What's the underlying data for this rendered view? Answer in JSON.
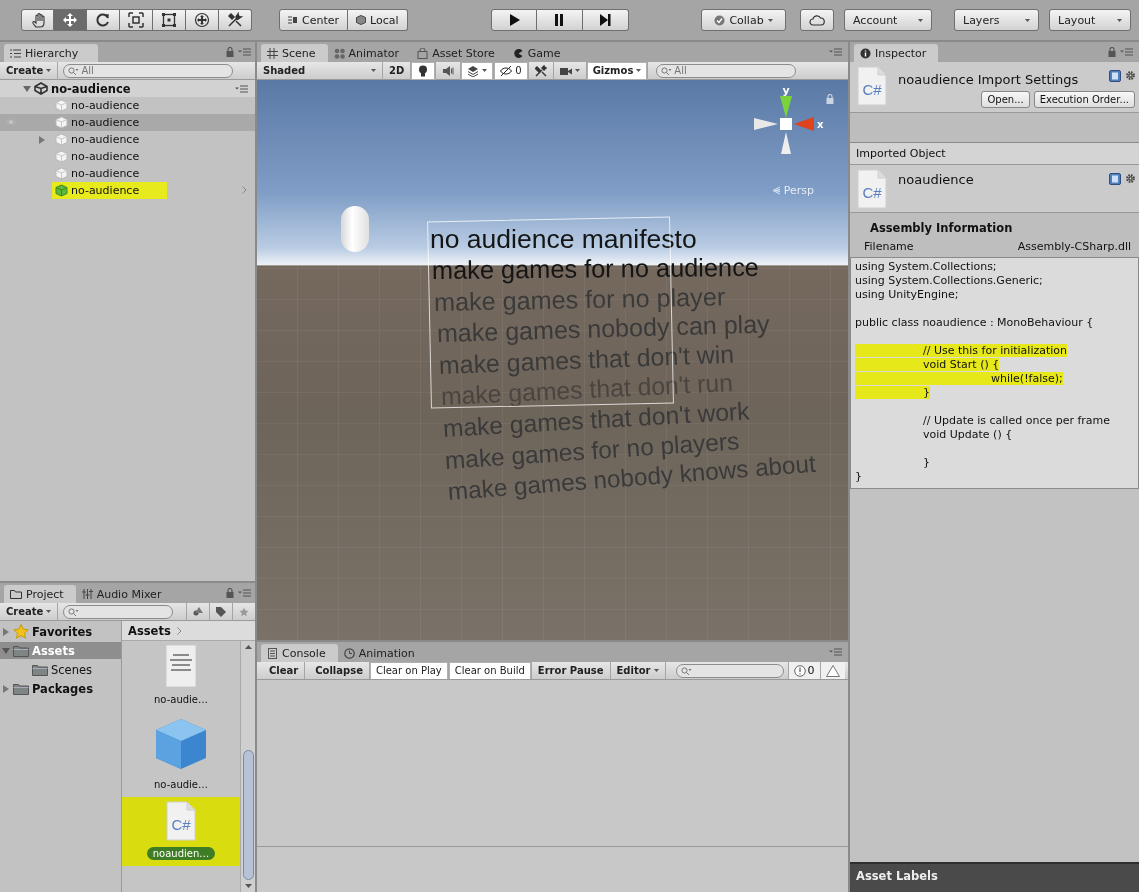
{
  "toolbar": {
    "tools": [
      {
        "kind": "hand",
        "selected": false
      },
      {
        "kind": "move",
        "selected": true
      },
      {
        "kind": "rotate",
        "selected": false
      },
      {
        "kind": "scale",
        "selected": false
      },
      {
        "kind": "rect",
        "selected": false
      },
      {
        "kind": "transform",
        "selected": false
      },
      {
        "kind": "custom",
        "selected": false
      }
    ],
    "pivot": [
      {
        "kind": "pivot",
        "label": "Center"
      },
      {
        "kind": "space",
        "label": "Local"
      }
    ],
    "playback": [
      {
        "kind": "play"
      },
      {
        "kind": "pause"
      },
      {
        "kind": "step"
      }
    ],
    "collab": "Collab",
    "account": "Account",
    "layers": "Layers",
    "layout": "Layout"
  },
  "hierarchy": {
    "tab": "Hierarchy",
    "create": "Create",
    "search_placeholder": "All",
    "scene": {
      "label": "no-audience",
      "expanded": true
    },
    "items": [
      {
        "label": "no-audience",
        "kind": "gameobject",
        "selected": false,
        "has_children": false,
        "marked": false
      },
      {
        "label": "no-audience",
        "kind": "gameobject",
        "selected": true,
        "has_children": false,
        "marked": false
      },
      {
        "label": "no-audience",
        "kind": "gameobject",
        "selected": false,
        "has_children": true,
        "marked": false
      },
      {
        "label": "no-audience",
        "kind": "gameobject",
        "selected": false,
        "has_children": false,
        "marked": false
      },
      {
        "label": "no-audience",
        "kind": "gameobject",
        "selected": false,
        "has_children": false,
        "marked": false
      },
      {
        "label": "no-audience",
        "kind": "prefab",
        "selected": false,
        "has_children": false,
        "marked": true
      }
    ]
  },
  "project": {
    "tabs": [
      {
        "label": "Project",
        "kind": "project",
        "selected": true
      },
      {
        "label": "Audio Mixer",
        "kind": "mixer",
        "selected": false
      }
    ],
    "create": "Create",
    "tree": [
      {
        "label": "Favorites",
        "kind": "favorites",
        "expanded": false,
        "selected": false
      },
      {
        "label": "Assets",
        "kind": "folder",
        "expanded": true,
        "selected": true,
        "children": [
          {
            "label": "Scenes",
            "kind": "folder",
            "selected": false
          }
        ]
      },
      {
        "label": "Packages",
        "kind": "folder",
        "expanded": false,
        "selected": false
      }
    ],
    "breadcrumb": "Assets",
    "assets": [
      {
        "label": "no-audie…",
        "kind": "scene",
        "selected": false,
        "marked": false
      },
      {
        "label": "no-audie…",
        "kind": "prefab",
        "selected": false,
        "marked": false
      },
      {
        "label": "noaudien…",
        "kind": "script",
        "icon_label": "C#",
        "selected": true,
        "marked": true
      }
    ]
  },
  "scene": {
    "tabs": [
      {
        "label": "Scene",
        "kind": "scene",
        "selected": true
      },
      {
        "label": "Animator",
        "kind": "animator",
        "selected": false
      },
      {
        "label": "Asset Store",
        "kind": "store",
        "selected": false
      },
      {
        "label": "Game",
        "kind": "game",
        "selected": false
      }
    ],
    "toolbar": {
      "shading": "Shaded",
      "two_d": {
        "label": "2D",
        "on": false
      },
      "toggles": [
        {
          "kind": "lighting",
          "on": true
        },
        {
          "kind": "audio",
          "on": false
        },
        {
          "kind": "effects",
          "on": true
        },
        {
          "kind": "hidden",
          "on": true,
          "label": "0"
        },
        {
          "kind": "tools",
          "on": false
        },
        {
          "kind": "camera",
          "on": false
        }
      ],
      "gizmos": {
        "label": "Gizmos",
        "on": true
      },
      "search_placeholder": "All"
    },
    "axes": [
      "y",
      "x"
    ],
    "projection": "Persp",
    "text_lines": [
      "no audience manifesto",
      "make games for no audience",
      "make games for no player",
      "make games nobody can play",
      "make games that don't win",
      "make games that don't run",
      "make games that don't work",
      "make games for no players",
      "make games nobody knows about"
    ]
  },
  "console": {
    "tabs": [
      {
        "label": "Console",
        "kind": "console",
        "selected": true
      },
      {
        "label": "Animation",
        "kind": "animation",
        "selected": false
      }
    ],
    "buttons": [
      {
        "label": "Clear",
        "on": false
      },
      {
        "label": "Collapse",
        "on": false
      },
      {
        "label": "Clear on Play",
        "on": true
      },
      {
        "label": "Clear on Build",
        "on": true
      },
      {
        "label": "Error Pause",
        "on": false
      }
    ],
    "target": "Editor",
    "counts": [
      {
        "kind": "info",
        "label": "0"
      },
      {
        "kind": "warning"
      }
    ]
  },
  "inspector": {
    "tab": "Inspector",
    "title": "noaudience Import Settings",
    "icon_label": "C#",
    "buttons": [
      "Open...",
      "Execution Order..."
    ],
    "section": "Imported Object",
    "object_icon_label": "C#",
    "object_name": "noaudience",
    "assembly_title": "Assembly Information",
    "field_label": "Filename",
    "field_value": "Assembly-CSharp.dll",
    "code": [
      {
        "text": "using System.Collections;",
        "marked": false,
        "blank_before": false
      },
      {
        "text": "using System.Collections.Generic;",
        "marked": false,
        "blank_before": false
      },
      {
        "text": "using UnityEngine;",
        "marked": false,
        "blank_before": false
      },
      {
        "text": "public class noaudience : MonoBehaviour {",
        "marked": false,
        "blank_before": true
      },
      {
        "text": "\t// Use this for initialization",
        "marked": true,
        "blank_before": true
      },
      {
        "text": "\tvoid Start () {",
        "marked": true,
        "blank_before": false
      },
      {
        "text": "\t\twhile(!false);",
        "marked": true,
        "blank_before": false
      },
      {
        "text": "\t}",
        "marked": true,
        "blank_before": false
      },
      {
        "text": "\t// Update is called once per frame",
        "marked": false,
        "blank_before": true
      },
      {
        "text": "\tvoid Update () {",
        "marked": false,
        "blank_before": false
      },
      {
        "text": "\t}",
        "marked": false,
        "blank_before": true
      },
      {
        "text": "}",
        "marked": false,
        "blank_before": false
      }
    ],
    "labels_title": "Asset Labels"
  }
}
